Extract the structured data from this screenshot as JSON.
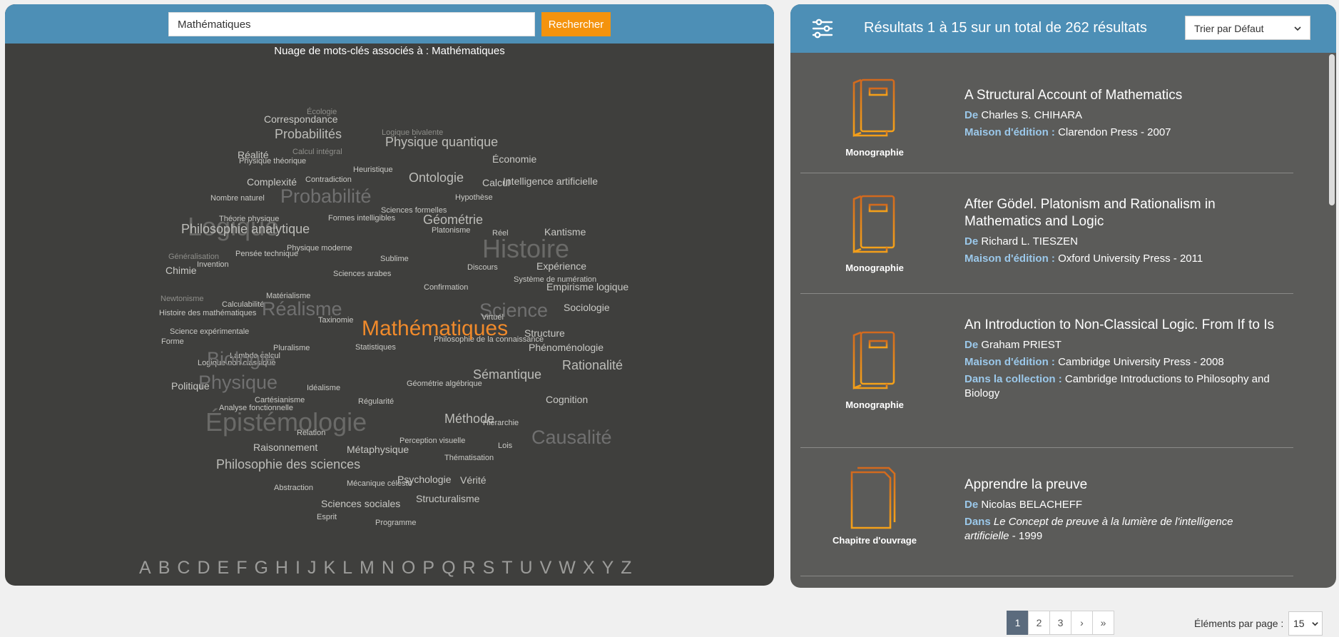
{
  "search": {
    "value": "Mathématiques",
    "button_label": "Rechercher"
  },
  "cloud": {
    "title": "Nuage de mots-clés associés à : Mathématiques",
    "main_keyword": "Mathématiques",
    "words": [
      "Écologie",
      "Correspondance",
      "Logique bivalente",
      "Probabilités",
      "Physique quantique",
      "Économie",
      "Réalité",
      "Calcul intégral",
      "Physique théorique",
      "Heuristique",
      "Complexité",
      "Ontologie",
      "Calcul",
      "Intelligence artificielle",
      "Contradiction",
      "Probabilité",
      "Hypothèse",
      "Nombre naturel",
      "Sciences formelles",
      "Théorie physique",
      "Géométrie",
      "Formes intelligibles",
      "Platonisme",
      "Kantisme",
      "Logique",
      "Philosophie analytique",
      "Histoire",
      "Réel",
      "Physique moderne",
      "Pensée technique",
      "Généralisation",
      "Sublime",
      "Invention",
      "Chimie",
      "Discours",
      "Expérience",
      "Sciences arabes",
      "Système de numération",
      "Empirisme logique",
      "Confirmation",
      "Calculabilité",
      "Matérialisme",
      "Réalisme",
      "Science",
      "Newtonisme",
      "Sociologie",
      "Histoire des mathématiques",
      "Taxinomie",
      "Virtuel",
      "Science expérimentale",
      "Structure",
      "Pluralisme",
      "Philosophie de la connaissance",
      "Forme",
      "Statistiques",
      "Phénoménologie",
      "Lambda calcul",
      "Logique non classique",
      "Biologie",
      "Rationalité",
      "Sémantique",
      "Physique",
      "Politique",
      "Idéalisme",
      "Géométrie algébrique",
      "Cartésianisme",
      "Régularité",
      "Cognition",
      "Analyse fonctionnelle",
      "Épistémologie",
      "Méthode",
      "Causalité",
      "Relation",
      "Hiérarchie",
      "Raisonnement",
      "Métaphysique",
      "Perception visuelle",
      "Lois",
      "Philosophie des sciences",
      "Thématisation",
      "Psychologie",
      "Vérité",
      "Structuralisme",
      "Sciences sociales",
      "Mécanique céleste",
      "Abstraction",
      "Esprit",
      "Programme"
    ],
    "alphabet": [
      "A",
      "B",
      "C",
      "D",
      "E",
      "F",
      "G",
      "H",
      "I",
      "J",
      "K",
      "L",
      "M",
      "N",
      "O",
      "P",
      "Q",
      "R",
      "S",
      "T",
      "U",
      "V",
      "W",
      "X",
      "Y",
      "Z"
    ]
  },
  "results": {
    "header": "Résultats 1 à 15 sur un total de 262 résultats",
    "sort_label": "Trier par Défaut",
    "items": [
      {
        "type": "Monographie",
        "title": "A Structural Account of Mathematics",
        "author_label": "De",
        "author": "Charles S. CHIHARA",
        "publisher_label": "Maison d'édition :",
        "publisher": "Clarendon Press - 2007"
      },
      {
        "type": "Monographie",
        "title": "After Gödel. Platonism and Rationalism in Mathematics and Logic",
        "author_label": "De",
        "author": "Richard L. TIESZEN",
        "publisher_label": "Maison d'édition :",
        "publisher": "Oxford University Press - 2011"
      },
      {
        "type": "Monographie",
        "title": "An Introduction to Non-Classical Logic. From If to Is",
        "author_label": "De",
        "author": "Graham PRIEST",
        "publisher_label": "Maison d'édition :",
        "publisher": "Cambridge University Press - 2008",
        "collection_label": "Dans la collection :",
        "collection": "Cambridge Introductions to Philosophy and Biology"
      },
      {
        "type": "Chapitre d'ouvrage",
        "title": "Apprendre la preuve",
        "author_label": "De",
        "author": "Nicolas BELACHEFF",
        "in_label": "Dans",
        "in_title": "Le Concept de preuve à la lumière de l'intelligence artificielle",
        "in_year": " - 1999"
      }
    ]
  },
  "pagination": {
    "pages": [
      "1",
      "2",
      "3"
    ],
    "next": "›",
    "last": "»",
    "active": "1"
  },
  "per_page": {
    "label": "Éléments par page :",
    "value": "15"
  },
  "colors": {
    "accent": "#f4930d",
    "header_blue": "#4d8fb6",
    "panel_dark": "#3f3f3d",
    "panel_gray": "#5b5b59",
    "label_blue": "#9bc8ea"
  }
}
